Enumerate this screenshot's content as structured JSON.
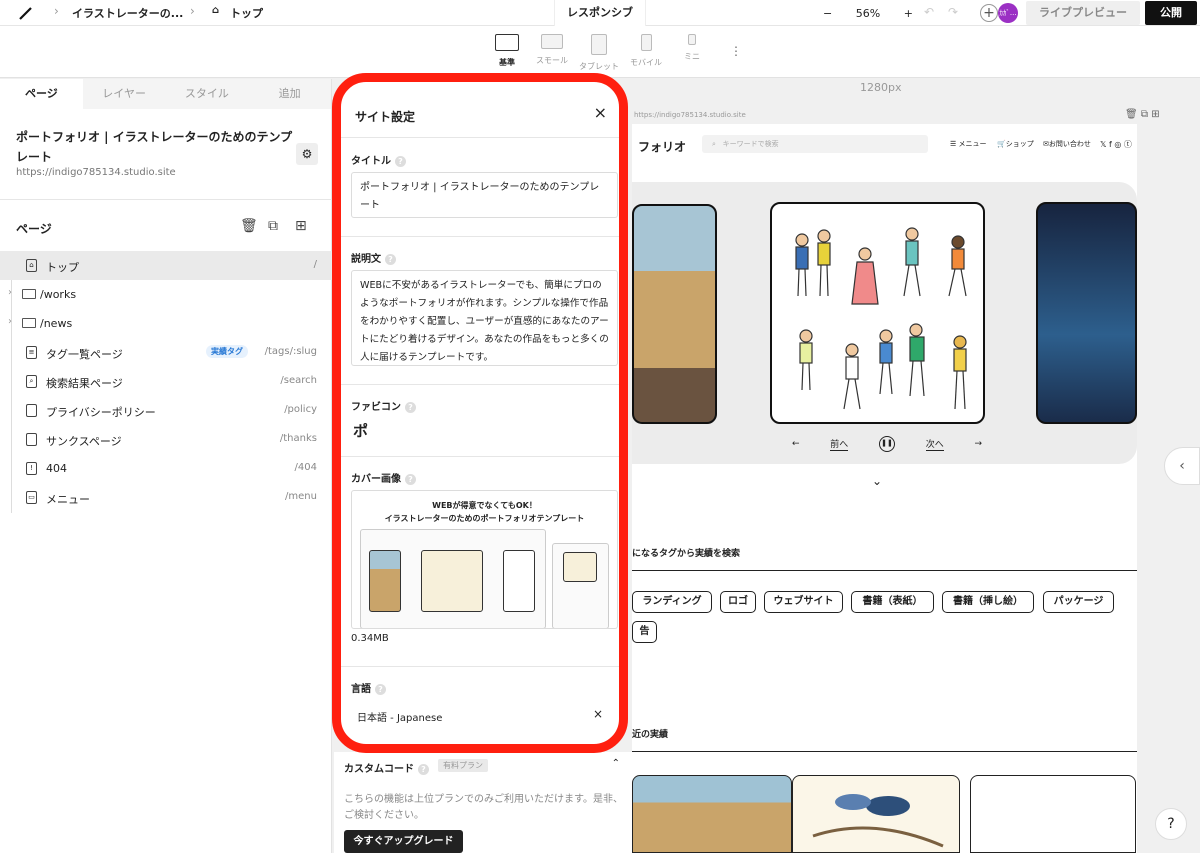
{
  "topbar": {
    "project_name": "イラストレーターの...",
    "page_name": "トップ",
    "responsive_label": "レスポンシブ",
    "zoom": "56%",
    "avatar_text": "ｶｶﾞ...",
    "live_preview": "ライブプレビュー",
    "publish": "公開"
  },
  "devices": [
    {
      "label": "基準",
      "active": true
    },
    {
      "label": "スモール",
      "active": false
    },
    {
      "label": "タブレット",
      "active": false
    },
    {
      "label": "モバイル",
      "active": false
    },
    {
      "label": "ミニ",
      "active": false
    }
  ],
  "sidebar": {
    "tabs": [
      "ページ",
      "レイヤー",
      "スタイル",
      "追加"
    ],
    "site_title": "ポートフォリオ | イラストレーターのためのテンプレート",
    "site_url": "https://indigo785134.studio.site",
    "pages_label": "ページ",
    "pages": [
      {
        "name": "トップ",
        "path": "/"
      },
      {
        "name": "/works",
        "path": ""
      },
      {
        "name": "/news",
        "path": ""
      },
      {
        "name": "タグ一覧ページ",
        "path": "/tags/:slug",
        "tag": "実績タグ"
      },
      {
        "name": "検索結果ページ",
        "path": "/search"
      },
      {
        "name": "プライバシーポリシー",
        "path": "/policy"
      },
      {
        "name": "サンクスページ",
        "path": "/thanks"
      },
      {
        "name": "404",
        "path": "/404"
      },
      {
        "name": "メニュー",
        "path": "/menu"
      }
    ]
  },
  "canvas": {
    "width_label": "1280px",
    "url_label": "https://indigo785134.studio.site",
    "site": {
      "logo": "フォリオ",
      "search_placeholder": "キーワードで検索",
      "nav": [
        "メニュー",
        "ショップ",
        "お問い合わせ"
      ],
      "prev": "前へ",
      "next": "次へ",
      "tags_title": "になるタグから実績を検索",
      "tags": [
        "ランディング",
        "ロゴ",
        "ウェブサイト",
        "書籍（表紙）",
        "書籍（挿し絵）",
        "パッケージ",
        "告"
      ],
      "recent_title": "近の実績"
    }
  },
  "modal": {
    "title": "サイト設定",
    "title_label": "タイトル",
    "title_value": "ポートフォリオ | イラストレーターのためのテンプレート",
    "desc_label": "説明文",
    "desc_value": "WEBに不安があるイラストレーターでも、簡単にプロのようなポートフォリオが作れます。シンプルな操作で作品をわかりやすく配置し、ユーザーが直感的にあなたのアートにたどり着けるデザイン。あなたの作品をもっと多くの人に届けるテンプレートです。",
    "favicon_label": "ファビコン",
    "favicon_char": "ポ",
    "cover_label": "カバー画像",
    "cover_heading_1": "WEBが得意でなくてもOK！",
    "cover_heading_2": "イラストレーターのためのポートフォリオテンプレート",
    "cover_size": "0.34MB",
    "lang_label": "言語",
    "lang_value": "日本語 - Japanese"
  },
  "custom_code": {
    "title": "カスタムコード",
    "badge": "有料プラン",
    "desc": "こちらの機能は上位プランでのみご利用いただけます。是非、ご検討ください。",
    "upgrade": "今すぐアップグレード"
  },
  "colors": {
    "highlight": "#ff1f0f",
    "accent": "#2a7ad5"
  }
}
